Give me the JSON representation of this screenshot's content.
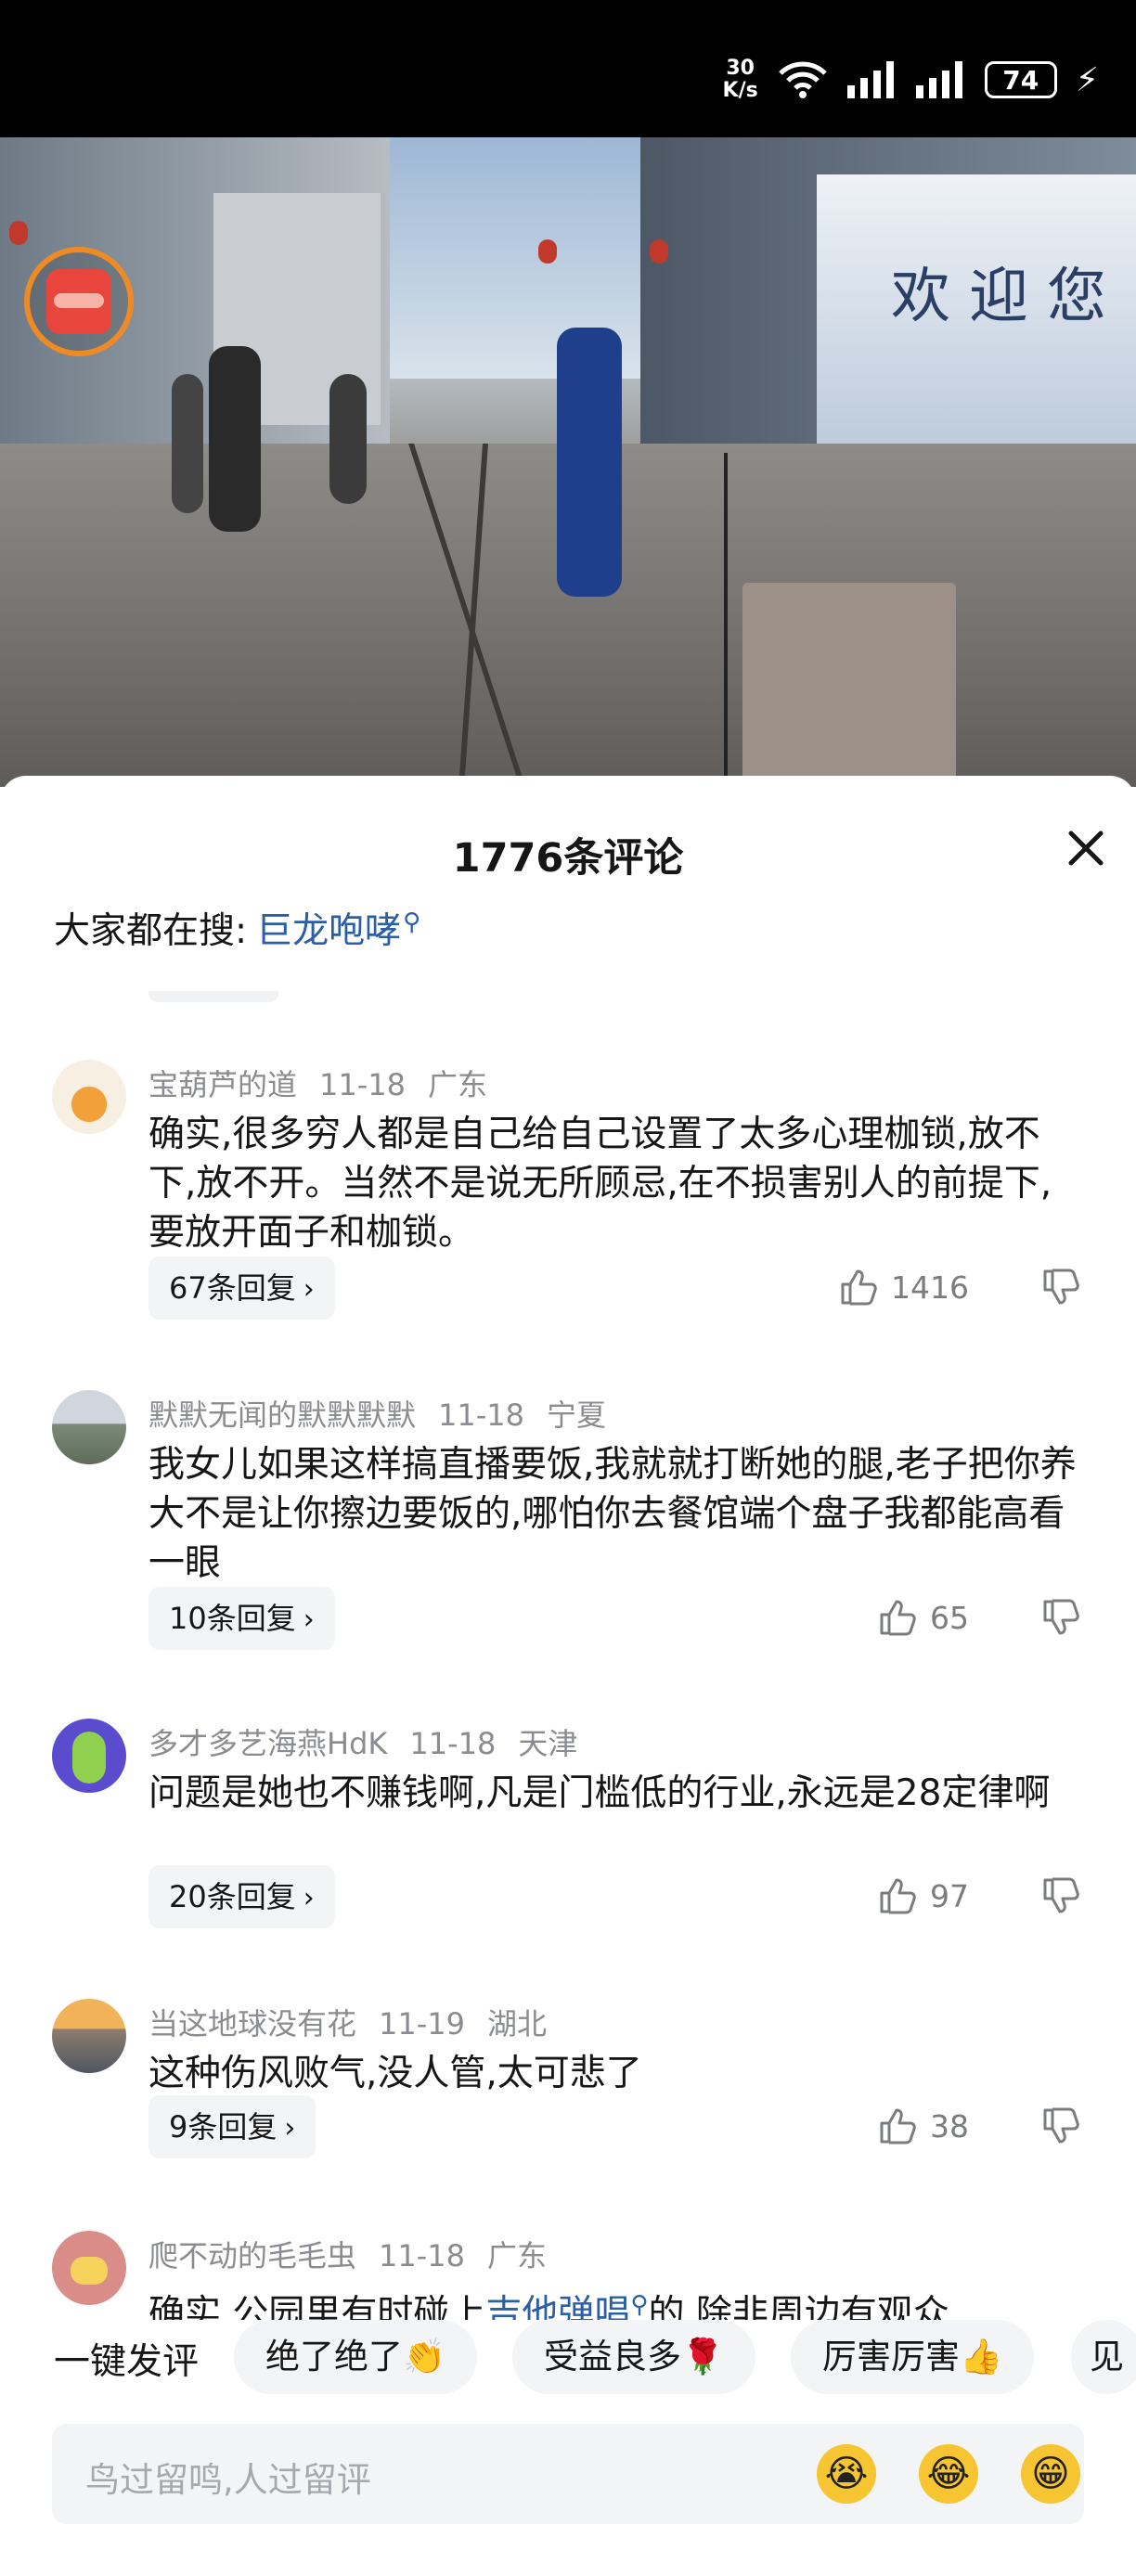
{
  "status_bar": {
    "net_speed_value": "30",
    "net_speed_unit": "K/s",
    "battery": "74"
  },
  "video": {
    "mural_text": "欢迎您"
  },
  "comments_panel": {
    "title": "1776条评论",
    "hot_search_label": "大家都在搜:",
    "hot_search_term": "巨龙咆哮"
  },
  "comments": [
    {
      "user": "宝葫芦的道",
      "date": "11-18",
      "location": "广东",
      "text": "确实,很多穷人都是自己给自己设置了太多心理枷锁,放不下,放不开。当然不是说无所顾忌,在不损害别人的前提下,要放开面子和枷锁。",
      "replies": "67条回复",
      "likes": "1416"
    },
    {
      "user": "默默无闻的默默默默",
      "date": "11-18",
      "location": "宁夏",
      "text": "我女儿如果这样搞直播要饭,我就就打断她的腿,老子把你养大不是让你擦边要饭的,哪怕你去餐馆端个盘子我都能高看一眼",
      "replies": "10条回复",
      "likes": "65"
    },
    {
      "user": "多才多艺海燕HdK",
      "date": "11-18",
      "location": "天津",
      "text": "问题是她也不赚钱啊,凡是门槛低的行业,永远是28定律啊",
      "replies": "20条回复",
      "likes": "97"
    },
    {
      "user": "当这地球没有花",
      "date": "11-19",
      "location": "湖北",
      "text": "这种伤风败气,没人管,太可悲了",
      "replies": "9条回复",
      "likes": "38"
    },
    {
      "user": "爬不动的毛毛虫",
      "date": "11-18",
      "location": "广东",
      "text_prefix": "确实,公园里有时碰上",
      "text_link": "吉他弹唱",
      "text_suffix": "的,除非周边有观众"
    }
  ],
  "quick_comments": {
    "label": "一键发评",
    "chips": [
      "绝了绝了👏",
      "受益良多🌹",
      "厉害厉害👍",
      "见"
    ]
  },
  "input": {
    "placeholder": "鸟过留鸣,人过留评",
    "emojis": [
      "😭",
      "😂",
      "😁"
    ]
  }
}
